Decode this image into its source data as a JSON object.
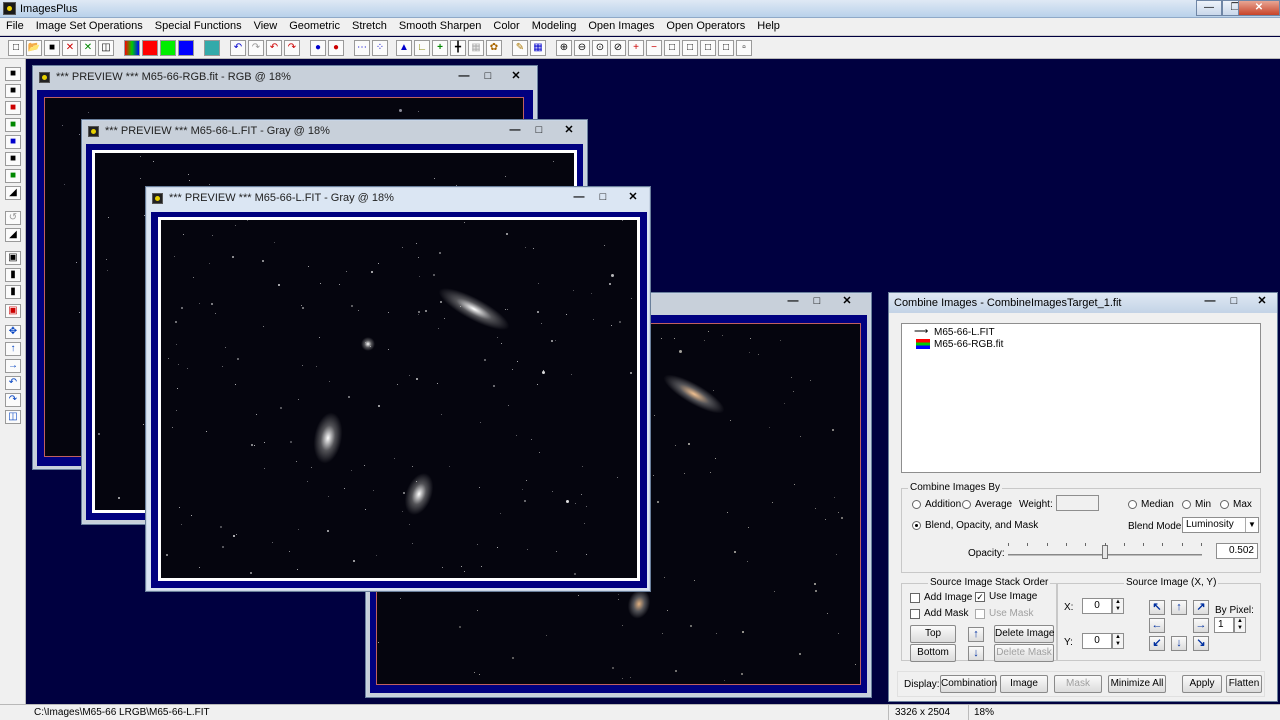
{
  "app": {
    "title": "ImagesPlus"
  },
  "menu": [
    "File",
    "Image Set Operations",
    "Special Functions",
    "View",
    "Geometric",
    "Stretch",
    "Smooth Sharpen",
    "Color",
    "Modeling",
    "Open Images",
    "Open Operators",
    "Help"
  ],
  "windows": {
    "w1": {
      "title": "*** PREVIEW *** M65-66-RGB.fit - RGB @ 18%"
    },
    "w2": {
      "title": "*** PREVIEW *** M65-66-L.FIT - Gray @ 18%"
    },
    "w3": {
      "title": "*** PREVIEW *** M65-66-L.FIT - Gray @ 18%"
    }
  },
  "combine": {
    "title": "Combine Images - CombineImagesTarget_1.fit",
    "files": [
      {
        "name": "M65-66-L.FIT",
        "icon": "arrow-icon"
      },
      {
        "name": "M65-66-RGB.fit",
        "icon": "rgb-icon"
      }
    ],
    "combine_by_label": "Combine Images By",
    "addition": "Addition",
    "average": "Average",
    "weight_label": "Weight:",
    "median": "Median",
    "min": "Min",
    "max": "Max",
    "blend_opacity_mask": "Blend, Opacity, and Mask",
    "blend_mode_label": "Blend Mode:",
    "blend_mode_value": "Luminosity",
    "opacity_label": "Opacity:",
    "opacity_value": "0.502",
    "opacity_fraction": 0.502,
    "stack_order_label": "Source Image Stack Order",
    "add_image": "Add Image",
    "use_image": "Use Image",
    "add_mask": "Add Mask",
    "use_mask": "Use Mask",
    "top": "Top",
    "bottom": "Bottom",
    "delete_image": "Delete Image",
    "delete_mask": "Delete Mask",
    "source_xy_label": "Source Image (X, Y)",
    "x_label": "X:",
    "y_label": "Y:",
    "x_value": "0",
    "y_value": "0",
    "by_pixel_label": "By Pixel:",
    "by_pixel_value": "1",
    "display_label": "Display:",
    "combination": "Combination",
    "image": "Image",
    "mask": "Mask",
    "minimize_all": "Minimize All",
    "apply": "Apply",
    "flatten": "Flatten"
  },
  "status": {
    "path": "C:\\Images\\M65-66 LRGB\\M65-66-L.FIT",
    "dimensions": "3326 x 2504",
    "zoom": "18%"
  },
  "colors": {
    "desktop": "#000040",
    "frame": "#00007f"
  }
}
